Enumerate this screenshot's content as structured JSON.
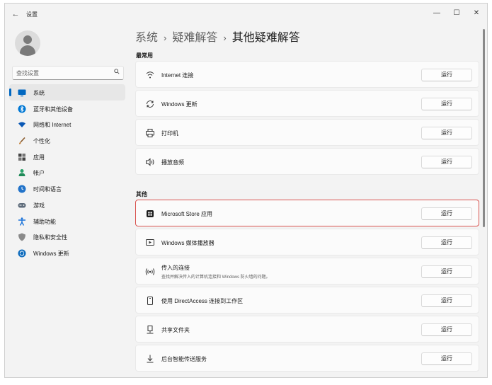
{
  "window": {
    "title": "设置",
    "back_glyph": "←",
    "minimize_glyph": "—",
    "maximize_glyph": "☐",
    "close_glyph": "✕"
  },
  "search": {
    "placeholder": "查找设置",
    "icon": "search-icon"
  },
  "sidebar": {
    "items": [
      {
        "label": "系统",
        "icon": "monitor-icon",
        "color": "#0067c0",
        "active": true
      },
      {
        "label": "蓝牙和其他设备",
        "icon": "bluetooth-icon",
        "color": "#0078d4"
      },
      {
        "label": "网络和 Internet",
        "icon": "wifi-icon",
        "color": "#0a58b5"
      },
      {
        "label": "个性化",
        "icon": "brush-icon",
        "color": "#c07a2f"
      },
      {
        "label": "应用",
        "icon": "apps-icon",
        "color": "#444444"
      },
      {
        "label": "帐户",
        "icon": "account-icon",
        "color": "#2aa36b"
      },
      {
        "label": "时间和语言",
        "icon": "globe-clock-icon",
        "color": "#2273c9"
      },
      {
        "label": "游戏",
        "icon": "gamepad-icon",
        "color": "#5e6b7a"
      },
      {
        "label": "辅助功能",
        "icon": "accessibility-icon",
        "color": "#1a73d9"
      },
      {
        "label": "隐私和安全性",
        "icon": "shield-icon",
        "color": "#6b6b6b"
      },
      {
        "label": "Windows 更新",
        "icon": "sync-icon",
        "color": "#0f6cbd"
      }
    ]
  },
  "breadcrumb": {
    "level1": "系统",
    "level2": "疑难解答",
    "current": "其他疑难解答",
    "separator": "›"
  },
  "sections": {
    "frequent": {
      "label": "最常用",
      "items": [
        {
          "title": "Internet 连接",
          "icon": "wifi-icon",
          "button": "运行"
        },
        {
          "title": "Windows 更新",
          "icon": "sync-icon",
          "button": "运行"
        },
        {
          "title": "打印机",
          "icon": "printer-icon",
          "button": "运行"
        },
        {
          "title": "播放音频",
          "icon": "speaker-icon",
          "button": "运行"
        }
      ]
    },
    "other": {
      "label": "其他",
      "items": [
        {
          "title": "Microsoft Store 应用",
          "icon": "store-icon",
          "button": "运行",
          "highlighted": true
        },
        {
          "title": "Windows 媒体播放器",
          "icon": "media-player-icon",
          "button": "运行"
        },
        {
          "title": "传入的连接",
          "desc": "查找并解决传入的计算机连接和 Windows 防火墙的问题。",
          "icon": "incoming-connection-icon",
          "button": "运行"
        },
        {
          "title": "使用 DirectAccess 连接到工作区",
          "icon": "phone-device-icon",
          "button": "运行"
        },
        {
          "title": "共享文件夹",
          "icon": "shared-folder-icon",
          "button": "运行"
        },
        {
          "title": "后台智能传送服务",
          "icon": "download-icon",
          "button": "运行"
        }
      ]
    }
  },
  "colors": {
    "accent": "#0067c0",
    "highlight_border": "#d9534f"
  }
}
